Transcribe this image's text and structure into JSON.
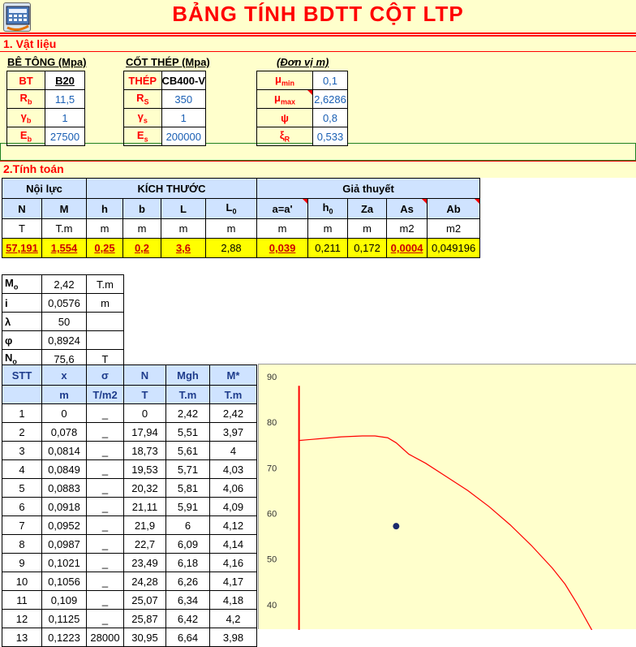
{
  "header": {
    "title": "BẢNG TÍNH BDTT CỘT LTP",
    "logo_icon": "calculator-app-icon"
  },
  "section1": {
    "title": "1. Vật liệu",
    "concrete": {
      "label": "BÊ TÔNG (Mpa)",
      "rows": [
        {
          "sym": "BT",
          "val": "B20"
        },
        {
          "sym": "Rb",
          "val": "11,5"
        },
        {
          "sym": "γb",
          "val": "1"
        },
        {
          "sym": "Eb",
          "val": "27500"
        }
      ]
    },
    "steel": {
      "label": "CỐT THÉP (Mpa)",
      "rows": [
        {
          "sym": "THÉP",
          "val": "CB400-V"
        },
        {
          "sym": "Rs",
          "val": "350"
        },
        {
          "sym": "γs",
          "val": "1"
        },
        {
          "sym": "Es",
          "val": "200000"
        }
      ]
    },
    "unit": {
      "label": "(Đơn vị m)",
      "rows": [
        {
          "sym": "μmin",
          "val": "0,1"
        },
        {
          "sym": "μmax",
          "val": "2,6286"
        },
        {
          "sym": "ψ",
          "val": "0,8"
        },
        {
          "sym": "ξR",
          "val": "0,533"
        }
      ]
    }
  },
  "section2": {
    "title": "2.Tính toán",
    "groups": {
      "noi_luc": "Nội lực",
      "kich_thuoc": "KÍCH THƯỚC",
      "gia_thuyet": "Giả thuyết"
    },
    "headers": [
      "N",
      "M",
      "h",
      "b",
      "L",
      "L0",
      "a=a'",
      "h0",
      "Za",
      "As",
      "Ab"
    ],
    "units": [
      "T",
      "T.m",
      "m",
      "m",
      "m",
      "m",
      "m",
      "m",
      "m",
      "m2",
      "m2"
    ],
    "values": [
      "57,191",
      "1,554",
      "0,25",
      "0,2",
      "3,6",
      "2,88",
      "0,039",
      "0,211",
      "0,172",
      "0,0004",
      "0,049196"
    ]
  },
  "mtable": [
    {
      "key": "Mo",
      "val": "2,42",
      "unit": "T.m"
    },
    {
      "key": "i",
      "val": "0,0576",
      "unit": "m"
    },
    {
      "key": "λ",
      "val": "50",
      "unit": ""
    },
    {
      "key": "φ",
      "val": "0,8924",
      "unit": ""
    },
    {
      "key": "No",
      "val": "75,6",
      "unit": "T"
    }
  ],
  "results": {
    "headers": [
      "STT",
      "x",
      "σ",
      "N",
      "Mgh",
      "M*"
    ],
    "units": [
      "",
      "m",
      "T/m2",
      "T",
      "T.m",
      "T.m"
    ],
    "rows": [
      [
        "1",
        "0",
        "_",
        "0",
        "2,42",
        "2,42"
      ],
      [
        "2",
        "0,078",
        "_",
        "17,94",
        "5,51",
        "3,97"
      ],
      [
        "3",
        "0,0814",
        "_",
        "18,73",
        "5,61",
        "4"
      ],
      [
        "4",
        "0,0849",
        "_",
        "19,53",
        "5,71",
        "4,03"
      ],
      [
        "5",
        "0,0883",
        "_",
        "20,32",
        "5,81",
        "4,06"
      ],
      [
        "6",
        "0,0918",
        "_",
        "21,11",
        "5,91",
        "4,09"
      ],
      [
        "7",
        "0,0952",
        "_",
        "21,9",
        "6",
        "4,12"
      ],
      [
        "8",
        "0,0987",
        "_",
        "22,7",
        "6,09",
        "4,14"
      ],
      [
        "9",
        "0,1021",
        "_",
        "23,49",
        "6,18",
        "4,16"
      ],
      [
        "10",
        "0,1056",
        "_",
        "24,28",
        "6,26",
        "4,17"
      ],
      [
        "11",
        "0,109",
        "_",
        "25,07",
        "6,34",
        "4,18"
      ],
      [
        "12",
        "0,1125",
        "_",
        "25,87",
        "6,42",
        "4,2"
      ],
      [
        "13",
        "0,1223",
        "28000",
        "30,95",
        "6,64",
        "3,98"
      ]
    ]
  },
  "chart_data": {
    "type": "line",
    "y_ticks": [
      "90",
      "80",
      "70",
      "60",
      "50",
      "40"
    ],
    "ylim": [
      25,
      90
    ],
    "xlim": [
      -0.3,
      8
    ],
    "curve_color": "#ff0000",
    "point_color": "#1a2a6c",
    "series": [
      {
        "points": [
          [
            0,
            76
          ],
          [
            0.5,
            76.4
          ],
          [
            1,
            76.8
          ],
          [
            1.5,
            77
          ],
          [
            1.8,
            77
          ],
          [
            2.1,
            76.6
          ],
          [
            2.3,
            75.5
          ],
          [
            2.6,
            73
          ],
          [
            3,
            71
          ],
          [
            3.5,
            68
          ],
          [
            4,
            65
          ],
          [
            4.5,
            61.5
          ],
          [
            5,
            57.5
          ],
          [
            5.5,
            53
          ],
          [
            6,
            48
          ],
          [
            6.3,
            44.5
          ],
          [
            6.6,
            40
          ],
          [
            6.9,
            35
          ],
          [
            7.2,
            30
          ],
          [
            7.4,
            27
          ]
        ]
      }
    ],
    "point": {
      "x": 2.3,
      "y": 57.2
    }
  }
}
